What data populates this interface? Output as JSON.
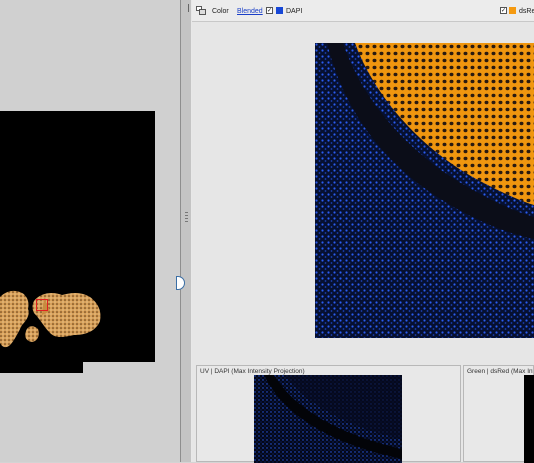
{
  "toolbar": {
    "color_label": "Color",
    "blended_link": "Blended",
    "dapi_channel": {
      "label": "DAPI",
      "checked": true,
      "color": "#1747d6"
    },
    "dsred_channel": {
      "label": "dsRed",
      "checked": true,
      "color": "#f59a10"
    },
    "layout_icon": "layout-icon"
  },
  "thumbnails": [
    {
      "title": "UV | DAPI (Max Intensity Projection)"
    },
    {
      "title": "Green | dsRed (Max Inte"
    }
  ],
  "colors": {
    "dapi_blue": "#1747d6",
    "dsred_orange": "#f59a10",
    "roi_red": "#e02020",
    "link_blue": "#1a3fc8"
  }
}
